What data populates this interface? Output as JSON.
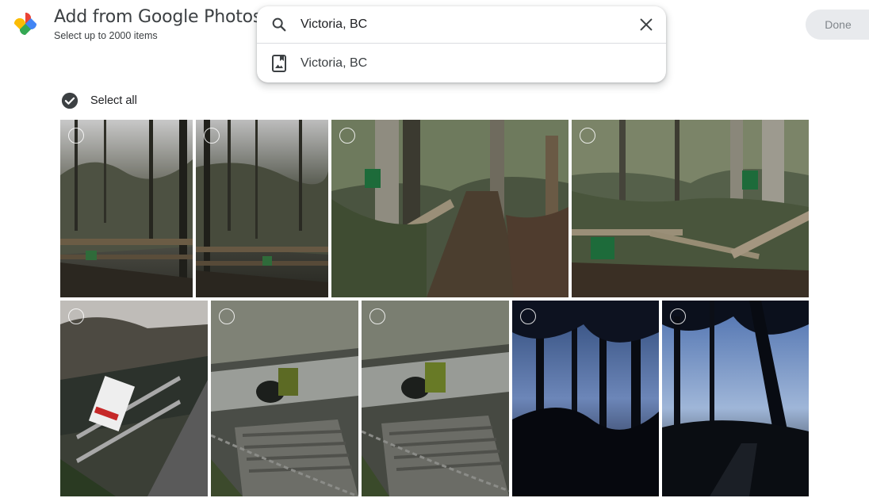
{
  "header": {
    "title": "Add from Google Photos",
    "subtitle": "Select up to 2000 items",
    "done_label": "Done"
  },
  "search": {
    "value": "Victoria, BC",
    "suggestion": "Victoria, BC",
    "search_icon": "search-icon",
    "clear_icon": "close-icon",
    "suggestion_icon": "album-icon"
  },
  "selection": {
    "select_all_label": "Select all",
    "icon": "check-circle-icon"
  },
  "photos": [
    {
      "row": 1,
      "scene": "forest-trail-fence-dusk",
      "selected": false
    },
    {
      "row": 1,
      "scene": "forest-trail-fence-dusk",
      "selected": false
    },
    {
      "row": 1,
      "scene": "forest-path-fence-sign",
      "selected": false
    },
    {
      "row": 1,
      "scene": "forest-fence-sign",
      "selected": false
    },
    {
      "row": 2,
      "scene": "stream-railing-sign",
      "selected": false
    },
    {
      "row": 2,
      "scene": "concrete-steps-bridge",
      "selected": false
    },
    {
      "row": 2,
      "scene": "concrete-steps-bridge",
      "selected": false
    },
    {
      "row": 2,
      "scene": "tree-silhouettes-night",
      "selected": false
    },
    {
      "row": 2,
      "scene": "tree-silhouettes-path",
      "selected": false
    }
  ],
  "colors": {
    "accent_blue": "#4285f4",
    "accent_red": "#ea4335",
    "accent_yellow": "#fbbc04",
    "accent_green": "#34a853",
    "done_bg": "#e8eaed"
  }
}
